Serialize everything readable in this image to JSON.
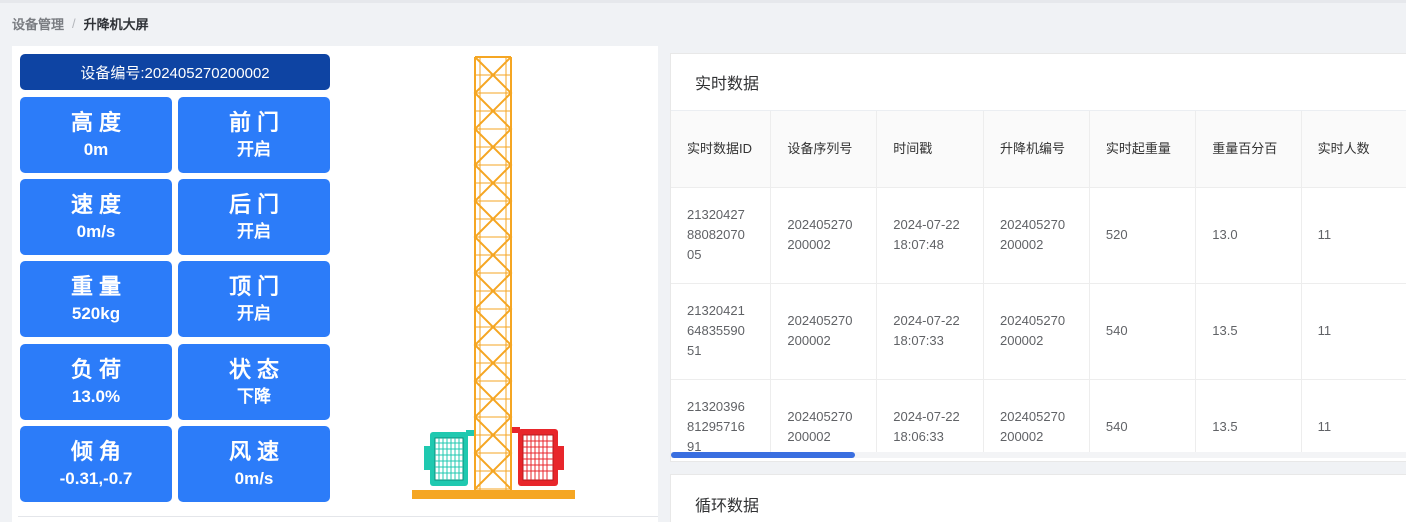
{
  "breadcrumb": {
    "parent": "设备管理",
    "separator": "/",
    "current": "升降机大屏"
  },
  "device": {
    "id_label": "设备编号:202405270200002"
  },
  "tiles": [
    {
      "label": "高度",
      "value": "0m"
    },
    {
      "label": "前门",
      "value": "开启"
    },
    {
      "label": "速度",
      "value": "0m/s"
    },
    {
      "label": "后门",
      "value": "开启"
    },
    {
      "label": "重量",
      "value": "520kg"
    },
    {
      "label": "顶门",
      "value": "开启"
    },
    {
      "label": "负荷",
      "value": "13.0%"
    },
    {
      "label": "状态",
      "value": "下降"
    },
    {
      "label": "倾角",
      "value": "-0.31,-0.7"
    },
    {
      "label": "风速",
      "value": "0m/s"
    }
  ],
  "realtime": {
    "title": "实时数据",
    "headers": [
      "实时数据ID",
      "设备序列号",
      "时间戳",
      "升降机编号",
      "实时起重量",
      "重量百分百",
      "实时人数"
    ],
    "rows": [
      [
        "21320427 88082070 05",
        "202405270 200002",
        "2024-07-22 18:07:48",
        "202405270 200002",
        "520",
        "13.0",
        "11"
      ],
      [
        "21320421 64835590 51",
        "202405270 200002",
        "2024-07-22 18:07:33",
        "202405270 200002",
        "540",
        "13.5",
        "11"
      ],
      [
        "21320396 81295716 91",
        "202405270 200002",
        "2024-07-22 18:06:33",
        "202405270 200002",
        "540",
        "13.5",
        "11"
      ]
    ]
  },
  "cycle": {
    "title": "循环数据"
  },
  "colors": {
    "tile_blue": "#2c7cf9",
    "header_navy": "#0e44a3",
    "tower_orange": "#f5a623",
    "cab_left": "#1fc9b0",
    "cab_right": "#e8262b"
  }
}
